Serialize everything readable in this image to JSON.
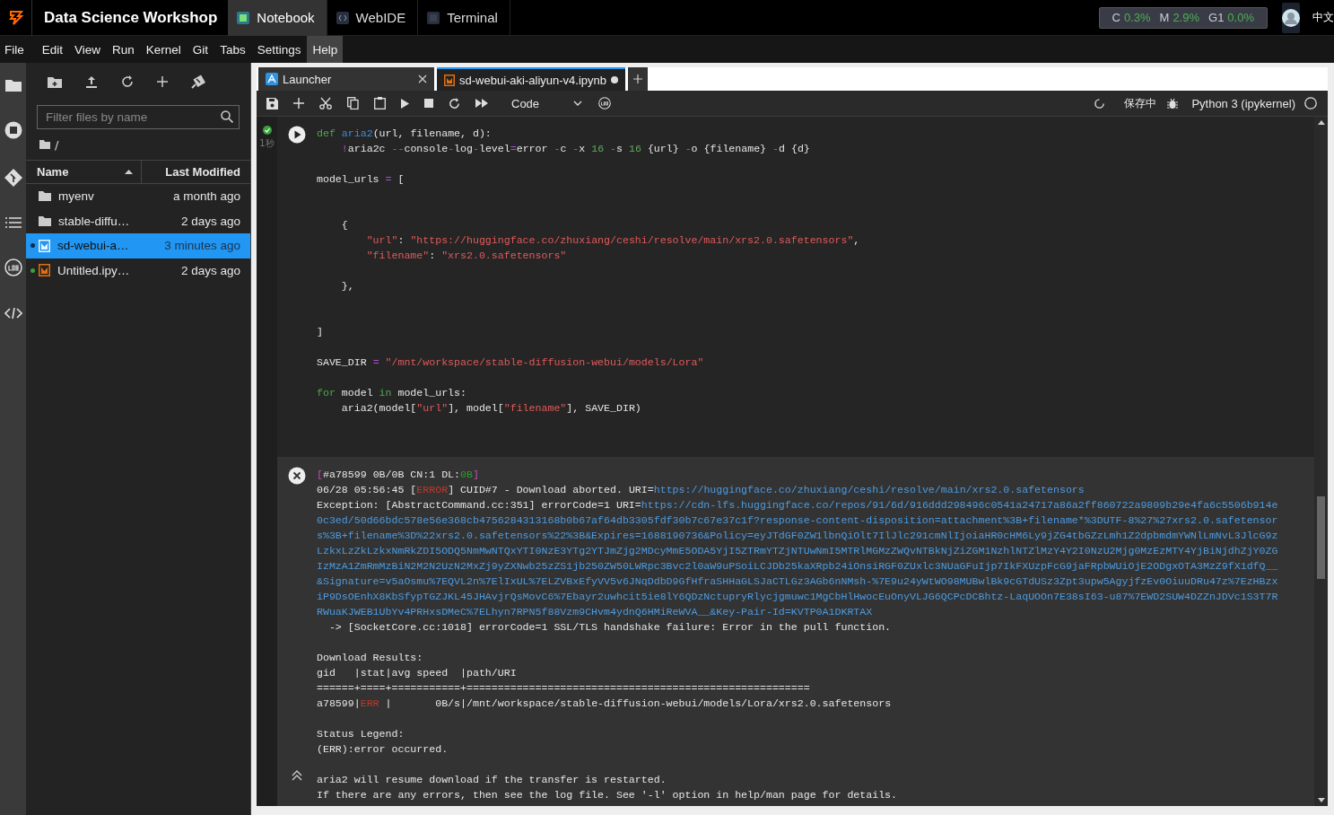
{
  "topbar": {
    "title": "Data Science Workshop",
    "tabs": [
      {
        "label": "Notebook",
        "kind": "notebook",
        "selected": true
      },
      {
        "label": "WebIDE",
        "kind": "ide",
        "selected": false
      },
      {
        "label": "Terminal",
        "kind": "terminal",
        "selected": false
      }
    ],
    "resources": [
      {
        "label": "C",
        "value": "0.3%"
      },
      {
        "label": "M",
        "value": "2.9%"
      },
      {
        "label": "G1",
        "value": "0.0%"
      }
    ],
    "language": "中文"
  },
  "menu": [
    {
      "label": "File",
      "selected": false
    },
    {
      "label": "Edit",
      "selected": false
    },
    {
      "label": "View",
      "selected": false
    },
    {
      "label": "Run",
      "selected": false
    },
    {
      "label": "Kernel",
      "selected": false
    },
    {
      "label": "Git",
      "selected": false
    },
    {
      "label": "Tabs",
      "selected": false
    },
    {
      "label": "Settings",
      "selected": false
    },
    {
      "label": "Help",
      "selected": true
    }
  ],
  "file_browser": {
    "filter_placeholder": "Filter files by name",
    "path": "/",
    "columns": [
      "Name",
      "Last Modified"
    ],
    "items": [
      {
        "kind": "folder",
        "name": "myenv",
        "modified": "a month ago",
        "selected": false,
        "running": false
      },
      {
        "kind": "folder",
        "name": "stable-diffu…",
        "modified": "2 days ago",
        "selected": false,
        "running": false
      },
      {
        "kind": "notebook",
        "name": "sd-webui-a…",
        "modified": "3 minutes ago",
        "selected": true,
        "running": true
      },
      {
        "kind": "notebook",
        "name": "Untitled.ipy…",
        "modified": "2 days ago",
        "selected": false,
        "running": true
      }
    ]
  },
  "notebook": {
    "tabs": [
      {
        "label": "Launcher",
        "kind": "launcher",
        "selected": false,
        "modified": false
      },
      {
        "label": "sd-webui-aki-aliyun-v4.ipynb",
        "kind": "notebook",
        "selected": true,
        "modified": true
      }
    ],
    "cell_type": "Code",
    "save_status": "保存中",
    "kernel": "Python 3 (ipykernel)",
    "cell": {
      "exec_time": "1秒",
      "code": [
        {
          "kind": "code",
          "tokens": [
            {
              "kind": "keyword",
              "text": "def "
            },
            {
              "kind": "function",
              "text": "aria2"
            },
            {
              "kind": "plain",
              "text": "(url, filename, d):"
            }
          ]
        },
        {
          "kind": "code",
          "tokens": [
            {
              "kind": "operator",
              "text": "    !"
            },
            {
              "kind": "plain",
              "text": "aria2c "
            },
            {
              "kind": "operator",
              "text": "--"
            },
            {
              "kind": "plain",
              "text": "console"
            },
            {
              "kind": "operator",
              "text": "-"
            },
            {
              "kind": "plain",
              "text": "log"
            },
            {
              "kind": "operator",
              "text": "-"
            },
            {
              "kind": "plain",
              "text": "level"
            },
            {
              "kind": "operator",
              "text": "="
            },
            {
              "kind": "plain",
              "text": "error "
            },
            {
              "kind": "operator",
              "text": "-"
            },
            {
              "kind": "plain",
              "text": "c "
            },
            {
              "kind": "operator",
              "text": "-"
            },
            {
              "kind": "plain",
              "text": "x "
            },
            {
              "kind": "number",
              "text": "16"
            },
            {
              "kind": "operator",
              "text": " -"
            },
            {
              "kind": "plain",
              "text": "s "
            },
            {
              "kind": "number",
              "text": "16"
            },
            {
              "kind": "plain",
              "text": " {url} "
            },
            {
              "kind": "operator",
              "text": "-"
            },
            {
              "kind": "plain",
              "text": "o {filename} "
            },
            {
              "kind": "operator",
              "text": "-"
            },
            {
              "kind": "plain",
              "text": "d {d}"
            }
          ]
        },
        {
          "kind": "blank"
        },
        {
          "kind": "code",
          "tokens": [
            {
              "kind": "plain",
              "text": "model_urls "
            },
            {
              "kind": "operator",
              "text": "="
            },
            {
              "kind": "plain",
              "text": " ["
            }
          ]
        },
        {
          "kind": "blank"
        },
        {
          "kind": "blank"
        },
        {
          "kind": "code",
          "tokens": [
            {
              "kind": "plain",
              "text": "    {"
            }
          ]
        },
        {
          "kind": "code",
          "tokens": [
            {
              "kind": "string",
              "text": "        \"url\""
            },
            {
              "kind": "plain",
              "text": ": "
            },
            {
              "kind": "string",
              "text": "\"https://huggingface.co/zhuxiang/ceshi/resolve/main/xrs2.0.safetensors\""
            },
            {
              "kind": "plain",
              "text": ","
            }
          ]
        },
        {
          "kind": "code",
          "tokens": [
            {
              "kind": "string",
              "text": "        \"filename\""
            },
            {
              "kind": "plain",
              "text": ": "
            },
            {
              "kind": "string",
              "text": "\"xrs2.0.safetensors\""
            }
          ]
        },
        {
          "kind": "blank"
        },
        {
          "kind": "code",
          "tokens": [
            {
              "kind": "plain",
              "text": "    },"
            }
          ]
        },
        {
          "kind": "blank"
        },
        {
          "kind": "blank"
        },
        {
          "kind": "code",
          "tokens": [
            {
              "kind": "plain",
              "text": "]"
            }
          ]
        },
        {
          "kind": "blank"
        },
        {
          "kind": "code",
          "tokens": [
            {
              "kind": "plain",
              "text": "SAVE_DIR "
            },
            {
              "kind": "operator",
              "text": "="
            },
            {
              "kind": "string",
              "text": " \"/mnt/workspace/stable-diffusion-webui/models/Lora\""
            }
          ]
        },
        {
          "kind": "blank"
        },
        {
          "kind": "code",
          "tokens": [
            {
              "kind": "keyword",
              "text": "for"
            },
            {
              "kind": "plain",
              "text": " model "
            },
            {
              "kind": "keyword",
              "text": "in"
            },
            {
              "kind": "plain",
              "text": " model_urls:"
            }
          ]
        },
        {
          "kind": "code",
          "tokens": [
            {
              "kind": "plain",
              "text": "    aria2(model["
            },
            {
              "kind": "string",
              "text": "\"url\""
            },
            {
              "kind": "plain",
              "text": "], model["
            },
            {
              "kind": "string",
              "text": "\"filename\""
            },
            {
              "kind": "plain",
              "text": "], SAVE_DIR)"
            }
          ]
        }
      ],
      "output": [
        {
          "kind": "code",
          "tokens": [
            {
              "kind": "bracket",
              "text": "["
            },
            {
              "kind": "plain",
              "text": "#a78599 0B/0B CN:1 DL:"
            },
            {
              "kind": "success",
              "text": "0B"
            },
            {
              "kind": "bracket",
              "text": "]"
            }
          ]
        },
        {
          "kind": "code",
          "tokens": [
            {
              "kind": "plain",
              "text": "06/28 05:56:45 ["
            },
            {
              "kind": "error",
              "text": "ERROR"
            },
            {
              "kind": "plain",
              "text": "] CUID#7 - Download aborted. URI="
            },
            {
              "kind": "link",
              "text": "https://huggingface.co/zhuxiang/ceshi/resolve/main/xrs2.0.safetensors"
            }
          ]
        },
        {
          "kind": "code",
          "tokens": [
            {
              "kind": "plain",
              "text": "Exception: [AbstractCommand.cc:351] errorCode=1 URI="
            },
            {
              "kind": "link",
              "text": "https://cdn-lfs.huggingface.co/repos/91/6d/916ddd298496c0541a24717a86a2ff860722a9809b29e4fa6c5506b914e"
            }
          ]
        },
        {
          "kind": "code",
          "tokens": [
            {
              "kind": "link",
              "text": "0c3ed/50d66bdc578e56e368cb4756284313168b0b67af64db3305fdf30b7c67e37c1f?response-content-disposition=attachment%3B+filename*%3DUTF-8%27%27xrs2.0.safetensor"
            }
          ]
        },
        {
          "kind": "code",
          "tokens": [
            {
              "kind": "link",
              "text": "s%3B+filename%3D%22xrs2.0.safetensors%22%3B&Expires=1688190736&Policy=eyJTdGF0ZW1lbnQiOlt7IlJlc291cmNlIjoiaHR0cHM6Ly9jZG4tbGZzLmh1Z2dpbmdmYWNlLmNvL3JlcG9z"
            }
          ]
        },
        {
          "kind": "code",
          "tokens": [
            {
              "kind": "link",
              "text": "LzkxLzZkLzkxNmRkZDI5ODQ5NmMwNTQxYTI0NzE3YTg2YTJmZjg2MDcyMmE5ODA5YjI5ZTRmYTZjNTUwNmI5MTRlMGMzZWQvNTBkNjZiZGM1NzhlNTZlMzY4Y2I0NzU2Mjg0MzEzMTY4YjBiNjdhZjY0ZG"
            }
          ]
        },
        {
          "kind": "code",
          "tokens": [
            {
              "kind": "link",
              "text": "IzMzA1ZmRmMzBiN2M2N2UzN2MxZj9yZXNwb25zZS1jb250ZW50LWRpc3Bvc2l0aW9uPSoiLCJDb25kaXRpb24iOnsiRGF0ZUxlc3NUaGFuIjp7IkFXUzpFcG9jaFRpbWUiOjE2ODgxOTA3MzZ9fX1dfQ__"
            }
          ]
        },
        {
          "kind": "code",
          "tokens": [
            {
              "kind": "link",
              "text": "&Signature=v5aOsmu%7EQVL2n%7ElIxUL%7ELZVBxEfyVV5v6JNqDdbD9GfHfraSHHaGLSJaCTLGz3AGb6nNMsh-%7E9u24yWtWO98MUBwlBk9cGTdUSz3Zpt3upw5AgyjfzEv0OiuuDRu47z%7EzHBzx"
            }
          ]
        },
        {
          "kind": "code",
          "tokens": [
            {
              "kind": "link",
              "text": "iP9DsOEnhX8KbSfypTGZJKL45JHAvjrQsMovC6%7Ebayr2uwhcit5ie8lY6QDzNctupryRlycjgmuwc1MgCbHlHwocEuOnyVLJG6QCPcDCBhtz-LaqUOOn7E38sI63-u87%7EWD2SUW4DZZnJDVc1S3T7R"
            }
          ]
        },
        {
          "kind": "code",
          "tokens": [
            {
              "kind": "link",
              "text": "RWuaKJWEB1UbYv4PRHxsDMeC%7ELhyn7RPN5f88Vzm9CHvm4ydnQ6HMiReWVA__&Key-Pair-Id=KVTP0A1DKRTAX"
            }
          ]
        },
        {
          "kind": "code",
          "tokens": [
            {
              "kind": "plain",
              "text": "  -> [SocketCore.cc:1018] errorCode=1 SSL/TLS handshake failure: Error in the pull function."
            }
          ]
        },
        {
          "kind": "blank"
        },
        {
          "kind": "code",
          "tokens": [
            {
              "kind": "plain",
              "text": "Download Results:"
            }
          ]
        },
        {
          "kind": "code",
          "tokens": [
            {
              "kind": "plain",
              "text": "gid   |stat|avg speed  |path/URI"
            }
          ]
        },
        {
          "kind": "code",
          "tokens": [
            {
              "kind": "plain",
              "text": "======+====+===========+======================================================="
            }
          ]
        },
        {
          "kind": "code",
          "tokens": [
            {
              "kind": "plain",
              "text": "a78599|"
            },
            {
              "kind": "error",
              "text": "ERR"
            },
            {
              "kind": "plain",
              "text": " |       0B/s|/mnt/workspace/stable-diffusion-webui/models/Lora/xrs2.0.safetensors"
            }
          ]
        },
        {
          "kind": "blank"
        },
        {
          "kind": "code",
          "tokens": [
            {
              "kind": "plain",
              "text": "Status Legend:"
            }
          ]
        },
        {
          "kind": "code",
          "tokens": [
            {
              "kind": "plain",
              "text": "(ERR):error occurred."
            }
          ]
        },
        {
          "kind": "blank"
        },
        {
          "kind": "code",
          "tokens": [
            {
              "kind": "plain",
              "text": "aria2 will resume download if the transfer is restarted."
            }
          ]
        },
        {
          "kind": "code",
          "tokens": [
            {
              "kind": "plain",
              "text": "If there are any errors, then see the log file. See '-l' option in help/man page for details."
            }
          ]
        }
      ]
    }
  }
}
